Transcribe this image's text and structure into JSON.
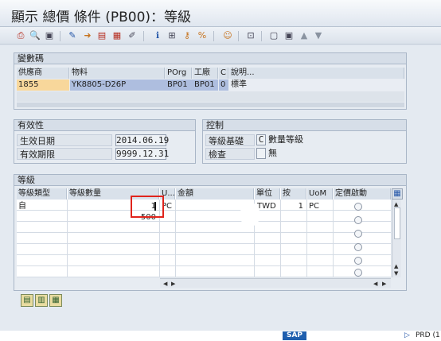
{
  "window": {
    "title": "顯示 總價 條件 (PB00)：等級"
  },
  "toolbar": {
    "icons": [
      "print-icon",
      "find-icon",
      "save-local-icon",
      "pencil-icon",
      "move-icon",
      "copy-icon",
      "gift-icon",
      "edit-icon",
      "info-icon",
      "layout-icon",
      "key-icon",
      "percent-icon",
      "person-icon",
      "split-icon",
      "doc-icon",
      "doc2-icon",
      "up-arrow-icon",
      "down-arrow-icon"
    ]
  },
  "variable_key": {
    "title": "變數碼",
    "headers": {
      "vendor": "供應商",
      "material": "物料",
      "porg": "POrg",
      "plant": "工廠",
      "c": "C",
      "desc": "說明..."
    },
    "row": {
      "vendor": "1855",
      "material": "YK8805-D26P",
      "porg": "BP01",
      "plant": "BP01",
      "c": "0",
      "desc": "標準"
    }
  },
  "validity": {
    "title": "有效性",
    "from_label": "生效日期",
    "from_value": "2014.06.19",
    "to_label": "有效期限",
    "to_value": "9999.12.31"
  },
  "control": {
    "title": "控制",
    "scale_basis_label": "等級基礎",
    "scale_basis_code": "C",
    "scale_basis_text": "數量等級",
    "check_label": "檢查",
    "check_code": "",
    "check_text": "無"
  },
  "scales": {
    "title": "等級",
    "headers": {
      "type": "等級類型",
      "qty": "等級數量",
      "u": "U...",
      "amount": "金額",
      "unit": "單位",
      "per": "按",
      "uom": "UoM",
      "fixed": "定價啟動"
    },
    "rows": [
      {
        "type": "自",
        "qty": "1",
        "u": "PC",
        "amount": "",
        "unit": "TWD",
        "per": "1",
        "uom": "PC"
      },
      {
        "type": "",
        "qty": "500",
        "u": "",
        "amount": "",
        "unit": "",
        "per": "",
        "uom": ""
      }
    ]
  },
  "footer": {
    "brand": "SAP",
    "status": "PRD (1"
  }
}
